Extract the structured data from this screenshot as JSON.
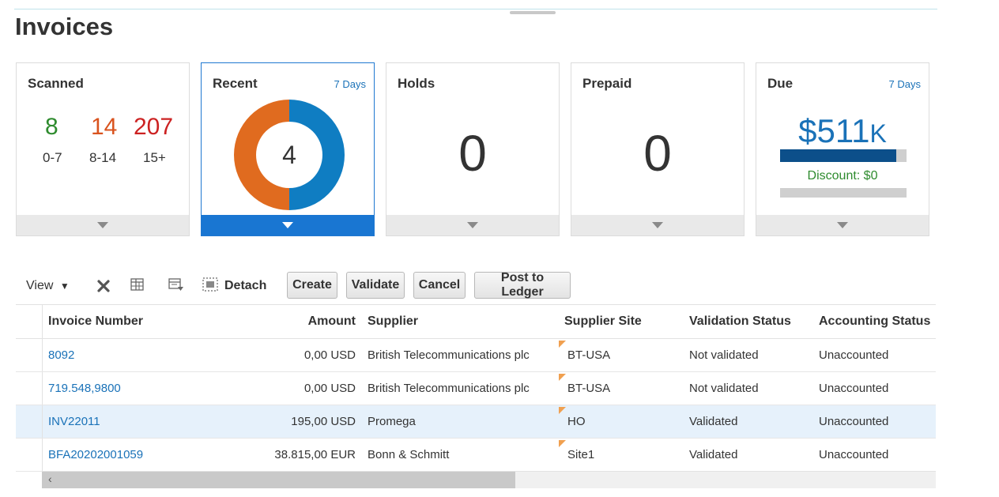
{
  "page": {
    "title": "Invoices"
  },
  "tiles": {
    "scanned": {
      "title": "Scanned",
      "buckets": [
        {
          "count": "8",
          "label": "0-7",
          "color": "#2e8b2e"
        },
        {
          "count": "14",
          "label": "8-14",
          "color": "#d9531e"
        },
        {
          "count": "207",
          "label": "15+",
          "color": "#cc2222"
        }
      ]
    },
    "recent": {
      "title": "Recent",
      "link": "7 Days",
      "count": "4",
      "donut": [
        {
          "value": 50,
          "color": "#0f7dc2"
        },
        {
          "value": 50,
          "color": "#e06b1f"
        }
      ]
    },
    "holds": {
      "title": "Holds",
      "count": "0"
    },
    "prepaid": {
      "title": "Prepaid",
      "count": "0"
    },
    "due": {
      "title": "Due",
      "link": "7 Days",
      "amount": "$511",
      "amount_suffix": "K",
      "bar_fill": 0.92,
      "discount": "Discount: $0"
    }
  },
  "toolbar": {
    "view": "View",
    "detach": "Detach",
    "buttons": [
      "Create",
      "Validate",
      "Cancel",
      "Post to Ledger"
    ]
  },
  "table": {
    "columns": [
      "Invoice Number",
      "Amount",
      "Supplier",
      "Supplier Site",
      "Validation Status",
      "Accounting Status"
    ],
    "rows": [
      {
        "invoice": "8092",
        "amount": "0,00 USD",
        "supplier": "British Telecommunications plc",
        "site": "BT-USA",
        "validation": "Not validated",
        "accounting": "Unaccounted",
        "selected": false
      },
      {
        "invoice": "719.548,9800",
        "amount": "0,00 USD",
        "supplier": "British Telecommunications plc",
        "site": "BT-USA",
        "validation": "Not validated",
        "accounting": "Unaccounted",
        "selected": false
      },
      {
        "invoice": "INV22011",
        "amount": "195,00 USD",
        "supplier": "Promega",
        "site": "HO",
        "validation": "Validated",
        "accounting": "Unaccounted",
        "selected": true
      },
      {
        "invoice": "BFA20202001059",
        "amount": "38.815,00 EUR",
        "supplier": "Bonn & Schmitt",
        "site": "Site1",
        "validation": "Validated",
        "accounting": "Unaccounted",
        "selected": false
      }
    ]
  },
  "scrollbar": {
    "position": 0.53
  }
}
